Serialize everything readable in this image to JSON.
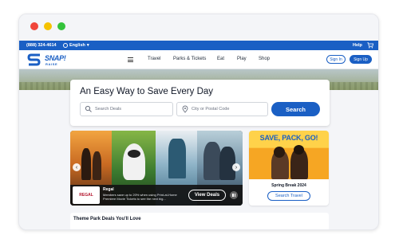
{
  "window": {
    "controls": [
      "close",
      "minimize",
      "maximize"
    ]
  },
  "topbar": {
    "phone": "(888) 324-4614",
    "language": "English",
    "help": "Help",
    "icons": {
      "globe": "globe-icon",
      "chevron": "chevron-down-icon",
      "cart": "cart-icon"
    }
  },
  "navbar": {
    "logo_text": "SNAP!",
    "logo_sub": "RAISE",
    "links": [
      "Travel",
      "Parks & Tickets",
      "Eat",
      "Play",
      "Shop"
    ],
    "sign_in": "Sign In",
    "sign_up": "Sign Up"
  },
  "search": {
    "title": "An Easy Way to Save Every Day",
    "deals_placeholder": "Search Deals",
    "location_placeholder": "City or Postal Code",
    "button": "Search"
  },
  "carousel": {
    "brand_logo": "REGAL",
    "deal_name": "Regal",
    "deal_desc": "Members save up to 20% when using Print-at-Home Premiere Movie Tickets to see the next big...",
    "cta": "View Deals"
  },
  "promo": {
    "headline": "SAVE, PACK, GO!",
    "caption": "Spring Break 2024",
    "button": "Search Travel"
  },
  "section": {
    "title": "Theme Park Deals You'll Love"
  },
  "colors": {
    "brand_blue": "#1a5fc4",
    "page_bg": "#f4f5f8",
    "close_dot": "#f0453a",
    "minimize_dot": "#f5c200",
    "maximize_dot": "#34c33b"
  }
}
